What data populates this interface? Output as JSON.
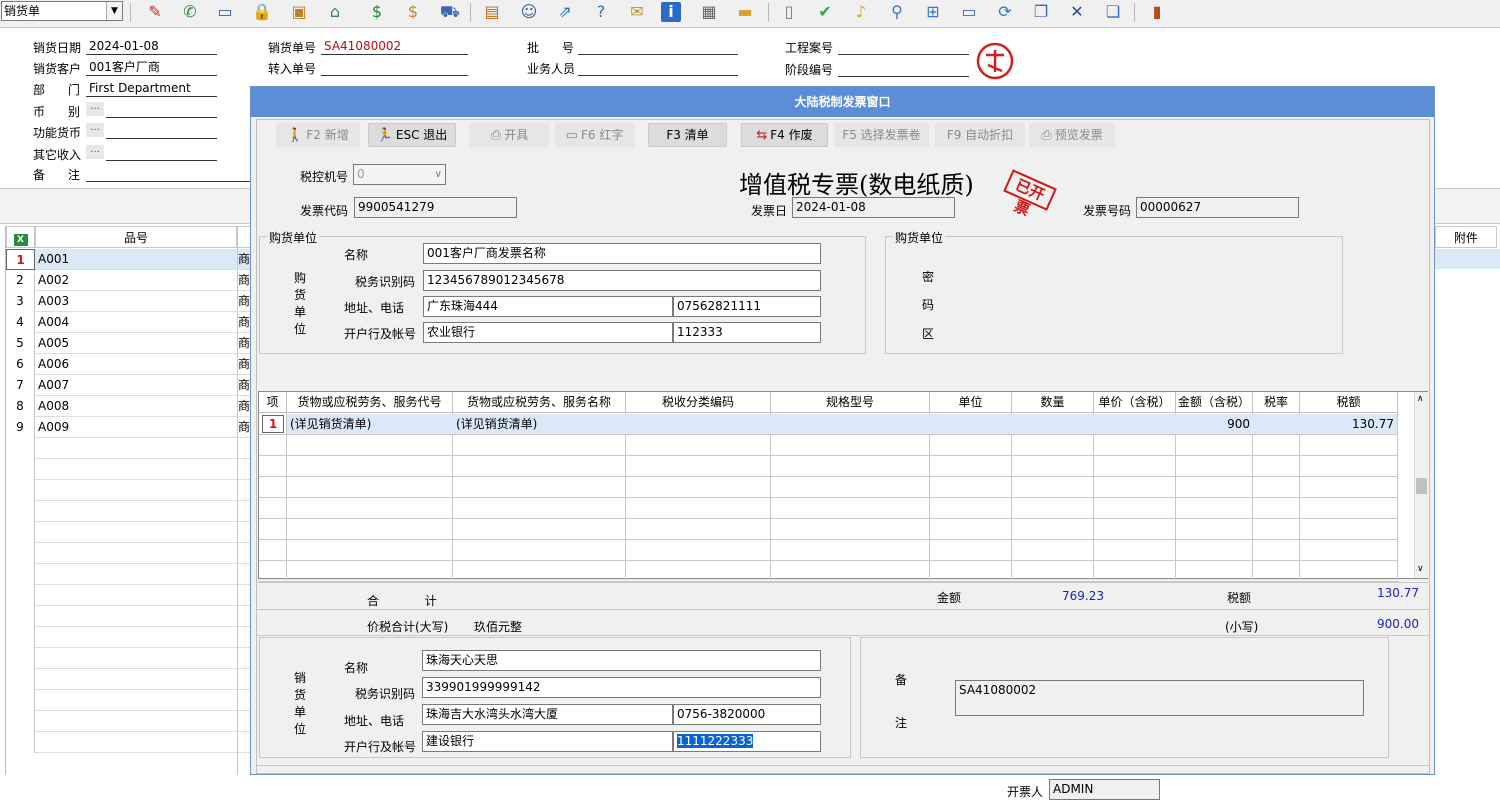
{
  "toolbar": {
    "form_select_value": "销货单",
    "icons": [
      "spell-check-icon",
      "phone-icon",
      "monitor-icon",
      "lock-icon",
      "briefcase-icon",
      "home-icon",
      "dollar-icon",
      "money-bag-icon",
      "cart-icon",
      "clipboard-icon",
      "users-icon",
      "link-icon",
      "help-icon",
      "mail-icon",
      "info-icon",
      "calculator-icon",
      "folder-icon",
      "document-icon",
      "check-circle-icon",
      "bell-icon",
      "search-icon",
      "org-chart-icon",
      "computer-icon",
      "refresh-icon",
      "windows-icon",
      "close-icon",
      "restore-icon",
      "exit-door-icon"
    ]
  },
  "bg_form": {
    "sale_date_label": "销货日期",
    "sale_date": "2024-01-08",
    "customer_label": "销货客户",
    "customer": "001客户厂商",
    "dept_label": "部      门",
    "dept": "First Department",
    "currency_label": "币      别",
    "func_currency_label": "功能货币",
    "other_income_label": "其它收入",
    "remark_label": "备      注",
    "order_no_label": "销货单号",
    "order_no": "SA41080002",
    "transfer_no_label": "转入单号",
    "batch_label": "批      号",
    "salesman_label": "业务人员",
    "project_label": "工程案号",
    "stage_label": "阶段编号",
    "grid_product_header": "品号",
    "grid_attach_header": "附件",
    "rows": [
      {
        "n": "1",
        "code": "A001",
        "suffix": "商"
      },
      {
        "n": "2",
        "code": "A002",
        "suffix": "商"
      },
      {
        "n": "3",
        "code": "A003",
        "suffix": "商"
      },
      {
        "n": "4",
        "code": "A004",
        "suffix": "商"
      },
      {
        "n": "5",
        "code": "A005",
        "suffix": "商"
      },
      {
        "n": "6",
        "code": "A006",
        "suffix": "商"
      },
      {
        "n": "7",
        "code": "A007",
        "suffix": "商"
      },
      {
        "n": "8",
        "code": "A008",
        "suffix": "商"
      },
      {
        "n": "9",
        "code": "A009",
        "suffix": "商"
      }
    ]
  },
  "dialog": {
    "title": "大陆税制发票窗口",
    "buttons": {
      "new": "F2 新增",
      "exit": "ESC 退出",
      "issue": "开具",
      "red": "F6 红字",
      "list": "F3 清单",
      "void": "F4 作废",
      "select_roll": "F5 选择发票卷",
      "auto_discount": "F9 自动折扣",
      "preview": "预览发票"
    },
    "tax_machine_label": "税控机号",
    "tax_machine_value": "0",
    "invoice_title": "增值税专票(数电纸质)",
    "issued_stamp": "已开票",
    "invoice_code_label": "发票代码",
    "invoice_code": "9900541279",
    "invoice_date_label": "发票日",
    "invoice_date": "2024-01-08",
    "invoice_no_label": "发票号码",
    "invoice_no": "00000627",
    "buyer": {
      "group_label": "购货单位",
      "vertical_label": [
        "购",
        "货",
        "单",
        "位"
      ],
      "name_label": "名称",
      "name": "001客户厂商发票名称",
      "tax_id_label": "税务识别码",
      "tax_id": "123456789012345678",
      "addr_label": "地址、电话",
      "addr": "广东珠海444",
      "phone": "07562821111",
      "bank_label": "开户行及帐号",
      "bank": "农业银行",
      "account": "112333"
    },
    "cipher": {
      "group_label": "购货单位",
      "chars": [
        "密",
        "码",
        "区"
      ]
    },
    "items": {
      "columns": [
        "项",
        "货物或应税劳务、服务代号",
        "货物或应税劳务、服务名称",
        "税收分类编码",
        "规格型号",
        "单位",
        "数量",
        "单价（含税）",
        "金额（含税）",
        "税率",
        "税额"
      ],
      "rows": [
        {
          "n": "1",
          "code": "(详见销货清单)",
          "name": "(详见销货清单)",
          "amount": "900",
          "tax": "130.77"
        }
      ]
    },
    "totals": {
      "label": "合            计",
      "amount_label": "金额",
      "amount": "769.23",
      "tax_label": "税额",
      "tax": "130.77",
      "upper_label": "价税合计(大写)",
      "upper": "玖佰元整",
      "lower_label": "(小写)",
      "lower": "900.00"
    },
    "seller": {
      "vertical_label": [
        "销",
        "货",
        "单",
        "位"
      ],
      "name_label": "名称",
      "name": "珠海天心天思",
      "tax_id_label": "税务识别码",
      "tax_id": "339901999999142",
      "addr_label": "地址、电话",
      "addr": "珠海吉大水湾头水湾大厦",
      "phone": "0756-3820000",
      "bank_label": "开户行及帐号",
      "bank": "建设银行",
      "account": "1111222333"
    },
    "remark": {
      "label_top": "备",
      "label_bottom": "注",
      "value": "SA41080002"
    },
    "issuer_label": "开票人",
    "issuer": "ADMIN"
  }
}
